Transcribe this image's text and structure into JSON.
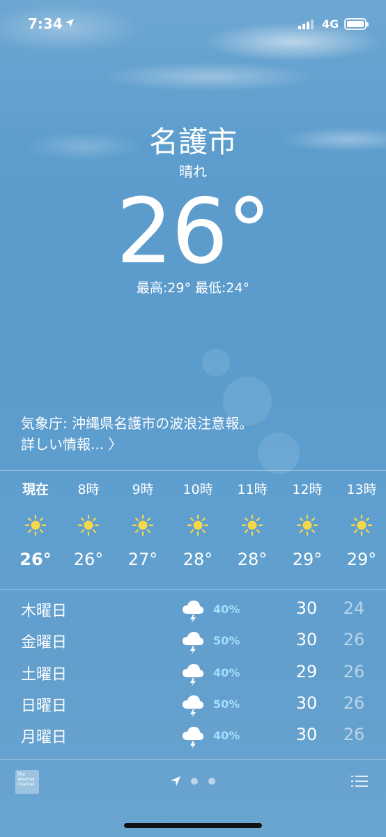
{
  "status_bar": {
    "time": "7:34",
    "network": "4G"
  },
  "weather": {
    "city": "名護市",
    "condition": "晴れ",
    "temperature": "26",
    "degree_symbol": "°",
    "hi_lo": "最高:29° 最低:24°"
  },
  "alert": {
    "text": "気象庁: 沖縄県名護市の波浪注意報。",
    "link": "詳しい情報... 〉"
  },
  "hourly": [
    {
      "label": "現在",
      "temp": "26°",
      "icon": "sun-icon"
    },
    {
      "label": "8時",
      "temp": "26°",
      "icon": "sun-icon"
    },
    {
      "label": "9時",
      "temp": "27°",
      "icon": "sun-icon"
    },
    {
      "label": "10時",
      "temp": "28°",
      "icon": "sun-icon"
    },
    {
      "label": "11時",
      "temp": "28°",
      "icon": "sun-icon"
    },
    {
      "label": "12時",
      "temp": "29°",
      "icon": "sun-icon"
    },
    {
      "label": "13時",
      "temp": "29°",
      "icon": "sun-icon"
    }
  ],
  "daily": [
    {
      "day": "木曜日",
      "precip": "40%",
      "high": "30",
      "low": "24",
      "icon": "thunderstorm-icon"
    },
    {
      "day": "金曜日",
      "precip": "50%",
      "high": "30",
      "low": "26",
      "icon": "thunderstorm-icon"
    },
    {
      "day": "土曜日",
      "precip": "40%",
      "high": "29",
      "low": "26",
      "icon": "thunderstorm-icon"
    },
    {
      "day": "日曜日",
      "precip": "50%",
      "high": "30",
      "low": "26",
      "icon": "thunderstorm-icon"
    },
    {
      "day": "月曜日",
      "precip": "40%",
      "high": "30",
      "low": "26",
      "icon": "thunderstorm-icon"
    }
  ],
  "footer": {
    "logo_text": "The Weather Channel"
  },
  "colors": {
    "precip": "#a8dcff",
    "sun": "#f5d84a",
    "sky": "#5a9bcc"
  }
}
